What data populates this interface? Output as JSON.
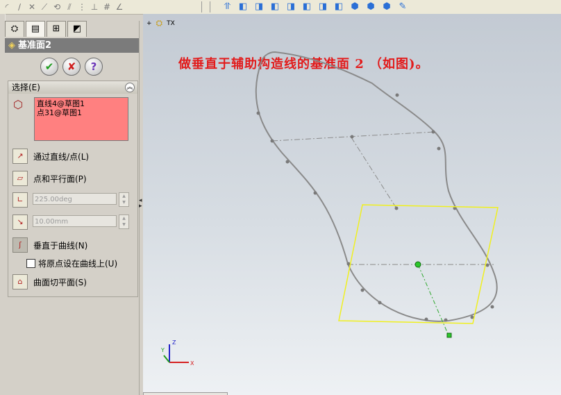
{
  "toolbar": {
    "left_icons": [
      "sketch-arc-icon",
      "sketch-line-icon",
      "trim-icon",
      "extend-icon",
      "offset-icon",
      "mirror-icon",
      "linear-pattern-icon",
      "dimension-icon",
      "grid-icon",
      "angle-icon"
    ],
    "right_icons": [
      "view-orientation-icon",
      "isometric-view-icon",
      "front-view-icon",
      "back-view-icon",
      "left-view-icon",
      "right-view-icon",
      "top-view-icon",
      "bottom-view-icon",
      "shaded-icon",
      "shaded-edges-icon",
      "section-view-icon",
      "appearance-icon"
    ]
  },
  "panel": {
    "tabs": [
      "feature-manager-tab",
      "property-manager-tab",
      "configuration-manager-tab",
      "dimxpert-tab"
    ],
    "title": "基准面2",
    "ok_label": "✔",
    "cancel_label": "✘",
    "help_label": "?",
    "selection": {
      "header": "选择(E)",
      "items": [
        "直线4@草图1",
        "点31@草图1"
      ],
      "selection_color": "#ff8080"
    },
    "options": {
      "through_line_point": "通过直线/点(L)",
      "point_parallel_plane": "点和平行面(P)",
      "angle_value": "225.00deg",
      "offset_value": "10.00mm",
      "normal_to_curve": "垂直于曲线(N)",
      "origin_on_curve": "将原点设在曲线上(U)",
      "tangent_to_surface": "曲面切平面(S)"
    }
  },
  "viewport": {
    "tx_label": "TX",
    "annotation": "做垂直于辅助构造线的基准面 2 （如图)。",
    "annotation_color": "#e21b1b",
    "triad": {
      "x": "X",
      "y": "Y",
      "z": "Z"
    }
  }
}
